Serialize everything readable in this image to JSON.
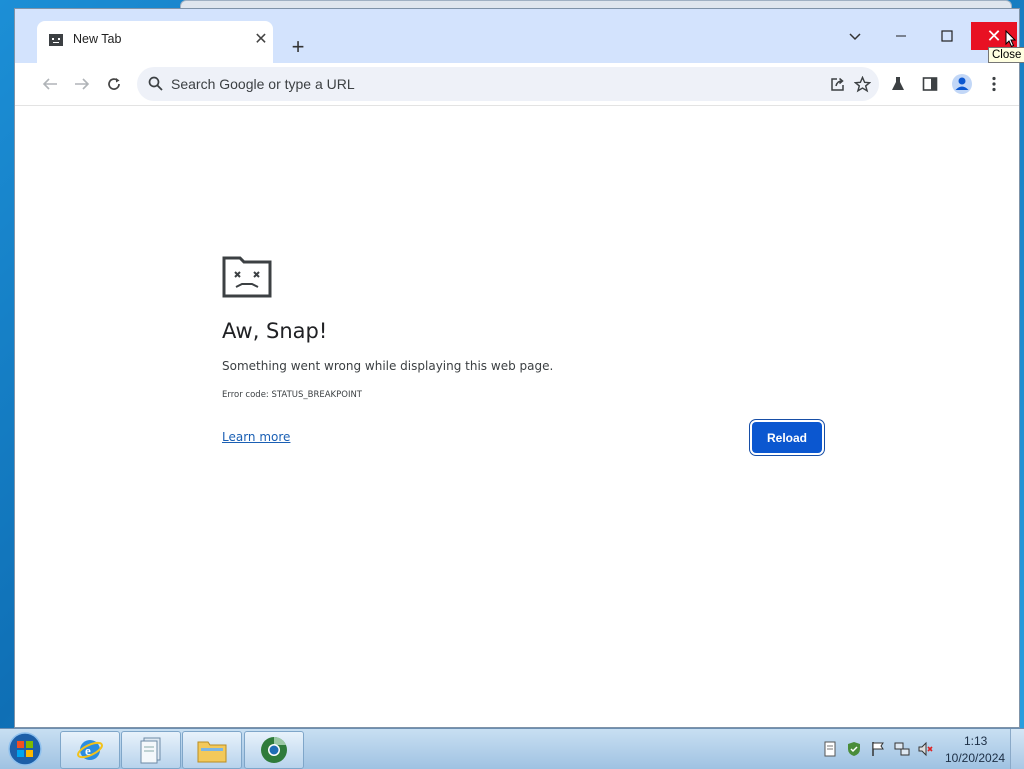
{
  "browser": {
    "tab": {
      "title": "New Tab",
      "favicon": "sad-folder-icon"
    },
    "new_tab_label": "+",
    "window_controls": {
      "dropdown": "chevron-down-icon",
      "minimize": "minimize-icon",
      "maximize": "maximize-icon",
      "close": "close-icon"
    },
    "toolbar": {
      "back": "back-arrow-icon",
      "forward": "forward-arrow-icon",
      "reload": "reload-icon",
      "omnibox_placeholder": "Search Google or type a URL",
      "icons": [
        "share-icon",
        "bookmark-star-icon",
        "labs-flask-icon",
        "side-panel-icon",
        "profile-avatar-icon",
        "more-menu-icon"
      ]
    },
    "tooltip": "Close"
  },
  "error_page": {
    "heading": "Aw, Snap!",
    "message": "Something went wrong while displaying this web page.",
    "error_code": "Error code: STATUS_BREAKPOINT",
    "learn_more": "Learn more",
    "reload_button": "Reload"
  },
  "taskbar": {
    "apps": [
      "internet-explorer-icon",
      "documents-icon",
      "explorer-folder-icon",
      "chrome-icon"
    ],
    "tray_icons": [
      "notes-icon",
      "security-shield-icon",
      "action-center-flag-icon",
      "network-icon",
      "volume-muted-icon"
    ],
    "clock": {
      "time": "1:13",
      "date": "10/20/2024"
    }
  },
  "colors": {
    "accent": "#0b57d0",
    "titlebar": "#d3e3fd",
    "close_red": "#e81123"
  }
}
